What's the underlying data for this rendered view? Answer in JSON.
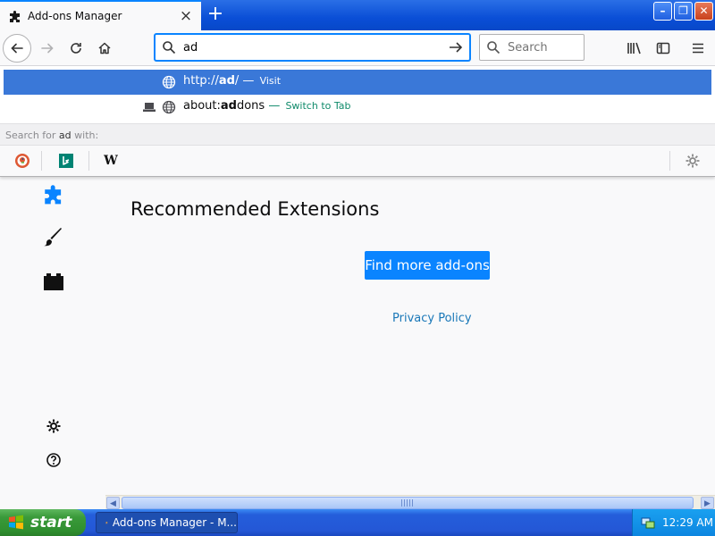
{
  "window": {
    "tab_title": "Add-ons Manager",
    "tab_close": "×",
    "new_tab": "+",
    "min": "–",
    "max": "❐",
    "close": "✕"
  },
  "urlbar": {
    "value": "ad",
    "search_placeholder": "Search"
  },
  "autocomplete": {
    "first": {
      "prefix": "http://",
      "bold": "ad",
      "suffix": "/",
      "dash": " — ",
      "action": "Visit"
    },
    "second": {
      "pre": "about:",
      "bold": "ad",
      "post": "dons",
      "dash": " — ",
      "action": "Switch to Tab"
    },
    "search_for_prefix": "Search for ",
    "search_for_term": "ad",
    "search_for_suffix": " with:",
    "engines": [
      "duckduckgo-icon",
      "bing-icon",
      "wikipedia-icon"
    ],
    "wikipedia_letter": "W"
  },
  "content": {
    "heading": "Recommended Extensions",
    "find_button": "Find more add-ons",
    "privacy_link": "Privacy Policy"
  },
  "taskbar": {
    "start_label": "start",
    "task_label": "Add-ons Manager - M...",
    "clock": "12:29 AM"
  },
  "colors": {
    "accent": "#0a84ff",
    "selection": "#3a78d8",
    "switch_to_tab": "#0f8a6a"
  }
}
